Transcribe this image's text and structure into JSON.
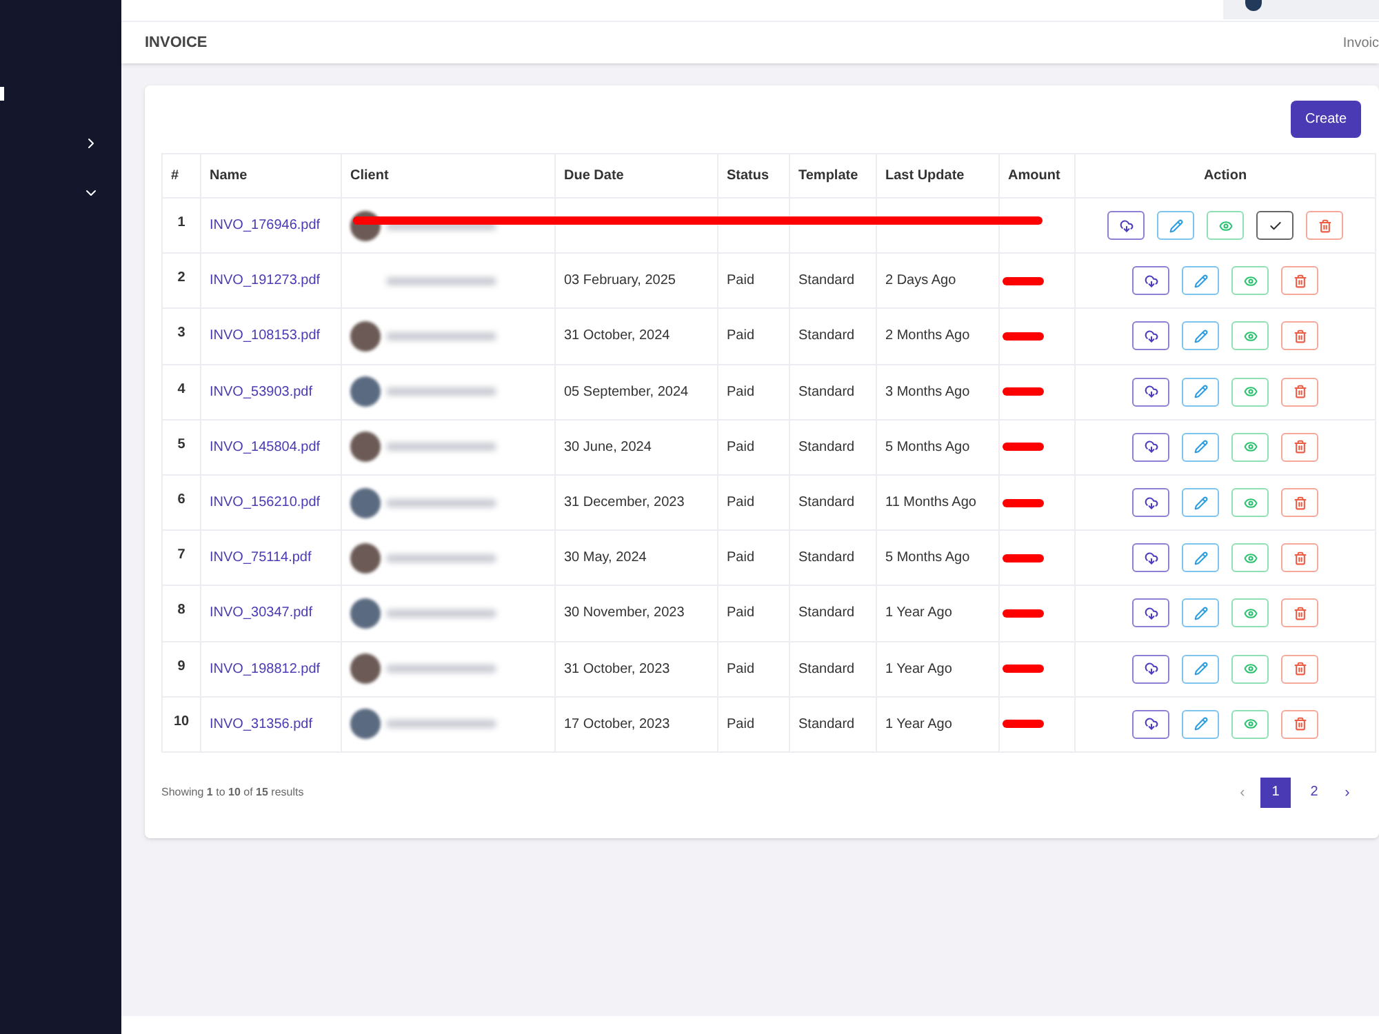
{
  "sidebar": {
    "items": [
      {
        "kind": "bar"
      },
      {
        "kind": "chevron-right"
      },
      {
        "kind": "chevron-down"
      }
    ]
  },
  "header": {
    "title": "INVOICE",
    "breadcrumb": "Invoic"
  },
  "create_button": "Create",
  "table": {
    "columns": [
      "#",
      "Name",
      "Client",
      "Due Date",
      "Status",
      "Template",
      "Last Update",
      "Amount",
      "Action"
    ],
    "rows": [
      {
        "index": "1",
        "name": "INVO_176946.pdf",
        "has_avatar": true,
        "redacted": true,
        "actions": [
          {
            "kind": "download"
          },
          {
            "kind": "edit"
          },
          {
            "kind": "view"
          },
          {
            "kind": "mark-paid"
          },
          {
            "kind": "delete"
          }
        ]
      },
      {
        "index": "2",
        "name": "INVO_191273.pdf",
        "has_avatar": false,
        "due_date": "03 February, 2025",
        "status": "Paid",
        "template": "Standard",
        "last_update": "2 Days Ago",
        "redacted": false,
        "actions": [
          {
            "kind": "download"
          },
          {
            "kind": "edit"
          },
          {
            "kind": "view"
          },
          {
            "kind": "delete"
          }
        ]
      },
      {
        "index": "3",
        "name": "INVO_108153.pdf",
        "has_avatar": true,
        "due_date": "31 October, 2024",
        "status": "Paid",
        "template": "Standard",
        "last_update": "2 Months Ago",
        "redacted": false,
        "actions": [
          {
            "kind": "download"
          },
          {
            "kind": "edit"
          },
          {
            "kind": "view"
          },
          {
            "kind": "delete"
          }
        ]
      },
      {
        "index": "4",
        "name": "INVO_53903.pdf",
        "has_avatar": true,
        "due_date": "05 September, 2024",
        "status": "Paid",
        "template": "Standard",
        "last_update": "3 Months Ago",
        "redacted": false,
        "actions": [
          {
            "kind": "download"
          },
          {
            "kind": "edit"
          },
          {
            "kind": "view"
          },
          {
            "kind": "delete"
          }
        ]
      },
      {
        "index": "5",
        "name": "INVO_145804.pdf",
        "has_avatar": true,
        "due_date": "30 June, 2024",
        "status": "Paid",
        "template": "Standard",
        "last_update": "5 Months Ago",
        "redacted": false,
        "actions": [
          {
            "kind": "download"
          },
          {
            "kind": "edit"
          },
          {
            "kind": "view"
          },
          {
            "kind": "delete"
          }
        ]
      },
      {
        "index": "6",
        "name": "INVO_156210.pdf",
        "has_avatar": true,
        "due_date": "31 December, 2023",
        "status": "Paid",
        "template": "Standard",
        "last_update": "11 Months Ago",
        "redacted": false,
        "actions": [
          {
            "kind": "download"
          },
          {
            "kind": "edit"
          },
          {
            "kind": "view"
          },
          {
            "kind": "delete"
          }
        ]
      },
      {
        "index": "7",
        "name": "INVO_75114.pdf",
        "has_avatar": true,
        "due_date": "30 May, 2024",
        "status": "Paid",
        "template": "Standard",
        "last_update": "5 Months Ago",
        "redacted": false,
        "actions": [
          {
            "kind": "download"
          },
          {
            "kind": "edit"
          },
          {
            "kind": "view"
          },
          {
            "kind": "delete"
          }
        ]
      },
      {
        "index": "8",
        "name": "INVO_30347.pdf",
        "has_avatar": true,
        "due_date": "30 November, 2023",
        "status": "Paid",
        "template": "Standard",
        "last_update": "1 Year Ago",
        "redacted": false,
        "actions": [
          {
            "kind": "download"
          },
          {
            "kind": "edit"
          },
          {
            "kind": "view"
          },
          {
            "kind": "delete"
          }
        ]
      },
      {
        "index": "9",
        "name": "INVO_198812.pdf",
        "has_avatar": true,
        "due_date": "31 October, 2023",
        "status": "Paid",
        "template": "Standard",
        "last_update": "1 Year Ago",
        "redacted": false,
        "actions": [
          {
            "kind": "download"
          },
          {
            "kind": "edit"
          },
          {
            "kind": "view"
          },
          {
            "kind": "delete"
          }
        ]
      },
      {
        "index": "10",
        "name": "INVO_31356.pdf",
        "has_avatar": true,
        "due_date": "17 October, 2023",
        "status": "Paid",
        "template": "Standard",
        "last_update": "1 Year Ago",
        "redacted": false,
        "actions": [
          {
            "kind": "download"
          },
          {
            "kind": "edit"
          },
          {
            "kind": "view"
          },
          {
            "kind": "delete"
          }
        ]
      }
    ]
  },
  "footer": {
    "summary": "Showing **1** to **10** of **15** results",
    "pagination": {
      "prev": "‹",
      "next": "›",
      "pages": [
        {
          "label": "1",
          "selected": true
        },
        {
          "label": "2",
          "selected": false
        }
      ]
    }
  }
}
